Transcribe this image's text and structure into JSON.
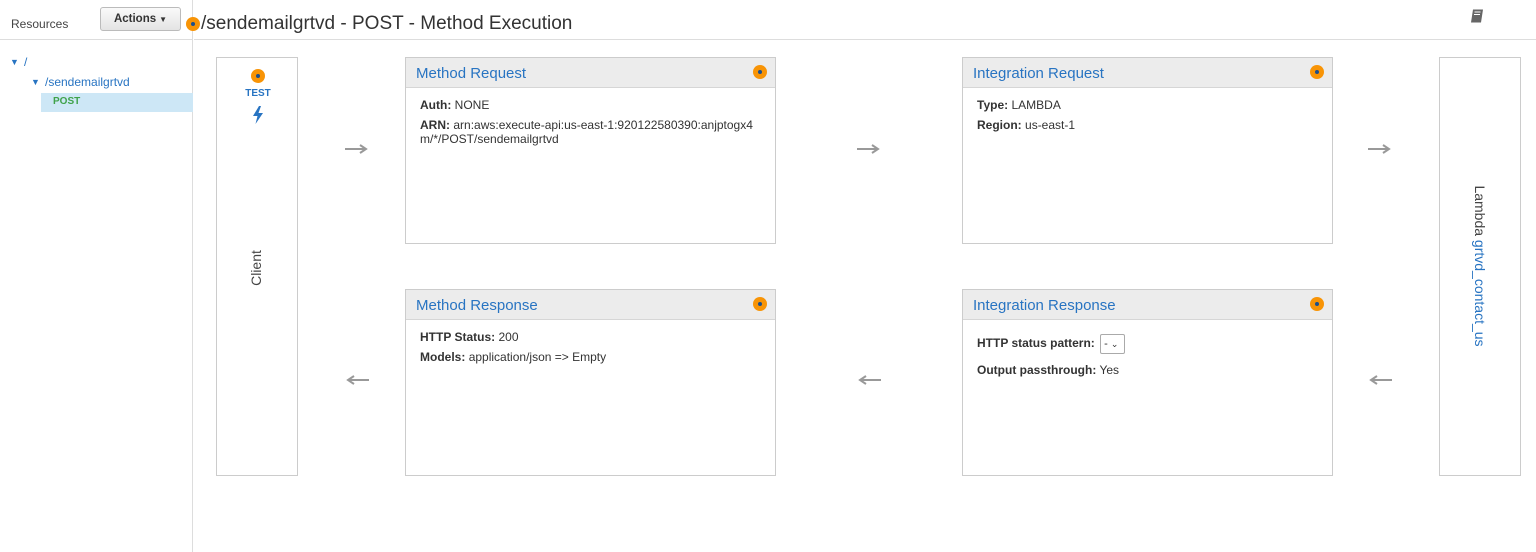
{
  "sidebar": {
    "title": "Resources",
    "actions_label": "Actions",
    "tree": {
      "root": "/",
      "resource": "/sendemailgrtvd",
      "method": "POST"
    }
  },
  "header": {
    "title": "/sendemailgrtvd - POST - Method Execution"
  },
  "client": {
    "test_label": "TEST",
    "label": "Client"
  },
  "lambda": {
    "prefix": "Lambda",
    "function_name": "grtvd_contact_us"
  },
  "method_request": {
    "title": "Method Request",
    "auth_label": "Auth:",
    "auth_value": "NONE",
    "arn_label": "ARN:",
    "arn_value": "arn:aws:execute-api:us-east-1:920122580390:anjptogx4m/*/POST/sendemailgrtvd"
  },
  "integration_request": {
    "title": "Integration Request",
    "type_label": "Type:",
    "type_value": "LAMBDA",
    "region_label": "Region:",
    "region_value": "us-east-1"
  },
  "method_response": {
    "title": "Method Response",
    "status_label": "HTTP Status:",
    "status_value": "200",
    "models_label": "Models:",
    "models_value": "application/json => Empty"
  },
  "integration_response": {
    "title": "Integration Response",
    "pattern_label": "HTTP status pattern:",
    "pattern_value": "-",
    "passthrough_label": "Output passthrough:",
    "passthrough_value": "Yes"
  },
  "colors": {
    "link": "#2874c2",
    "status_dot": "#f89406",
    "selected_row": "#cde7f6",
    "method_green": "#3fa24a",
    "arrow": "#999999"
  },
  "icons": [
    "caret-down-icon",
    "status-dot-icon",
    "book-icon",
    "bolt-icon",
    "arrow-right-icon",
    "arrow-left-icon",
    "tree-expand-icon"
  ]
}
